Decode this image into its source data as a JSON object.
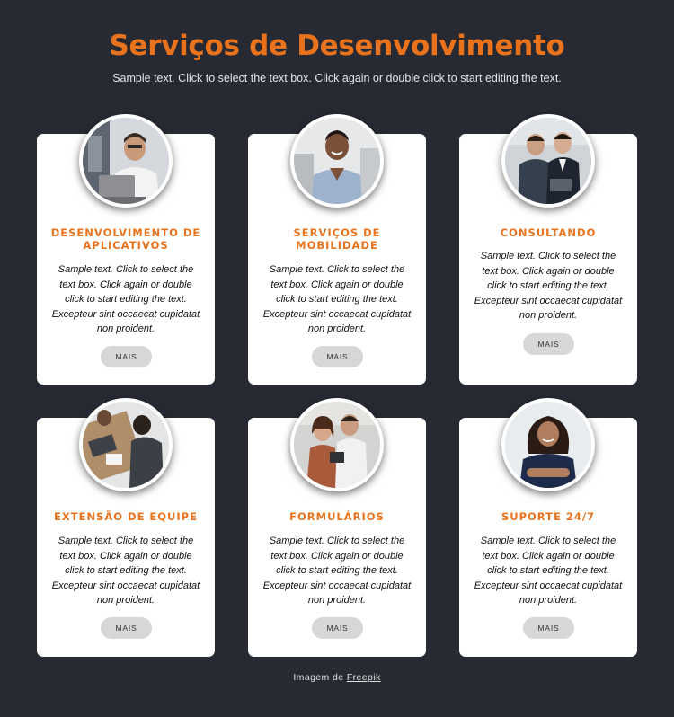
{
  "header": {
    "title": "Serviços de Desenvolvimento",
    "subtitle": "Sample text. Click to select the text box. Click again or double click to start editing the text."
  },
  "cards": [
    {
      "title": "Desenvolvimento de aplicativos",
      "text": "Sample text. Click to select the text box. Click again or double click to start editing the text. Excepteur sint occaecat cupidatat non proident.",
      "button": "MAIS"
    },
    {
      "title": "Serviços de mobilidade",
      "text": "Sample text. Click to select the text box. Click again or double click to start editing the text. Excepteur sint occaecat cupidatat non proident.",
      "button": "MAIS"
    },
    {
      "title": "Consultando",
      "text": "Sample text. Click to select the text box. Click again or double click to start editing the text. Excepteur sint occaecat cupidatat non proident.",
      "button": "MAIS"
    },
    {
      "title": "Extensão de equipe",
      "text": "Sample text. Click to select the text box. Click again or double click to start editing the text. Excepteur sint occaecat cupidatat non proident.",
      "button": "MAIS"
    },
    {
      "title": "Formulários",
      "text": "Sample text. Click to select the text box. Click again or double click to start editing the text. Excepteur sint occaecat cupidatat non proident.",
      "button": "MAIS"
    },
    {
      "title": "Suporte 24/7",
      "text": "Sample text. Click to select the text box. Click again or double click to start editing the text. Excepteur sint occaecat cupidatat non proident.",
      "button": "MAIS"
    }
  ],
  "footer": {
    "credit_prefix": "Imagem de",
    "credit_link": "Freepik"
  },
  "colors": {
    "background": "#272a33",
    "accent": "#e9731c",
    "card": "#ffffff",
    "button": "#d7d7d7"
  }
}
